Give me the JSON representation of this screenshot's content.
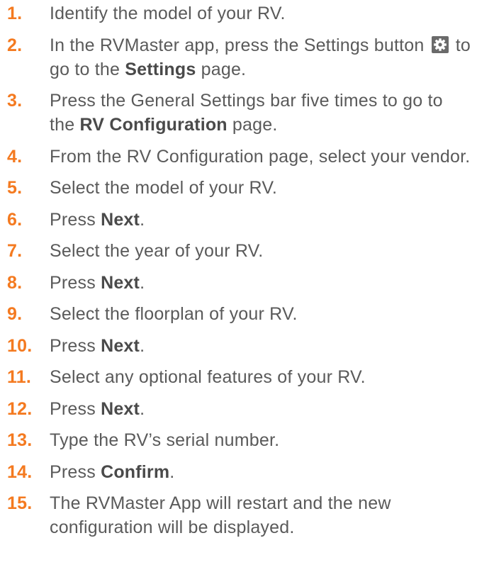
{
  "steps": [
    {
      "number": "1.",
      "parts": [
        {
          "t": "Identify the model of your RV."
        }
      ]
    },
    {
      "number": "2.",
      "parts": [
        {
          "t": "In the RVMaster app, press the Settings button "
        },
        {
          "icon": "settings-gear-icon"
        },
        {
          "t": " to go to the "
        },
        {
          "t": "Settings",
          "b": true
        },
        {
          "t": " page."
        }
      ]
    },
    {
      "number": "3.",
      "parts": [
        {
          "t": "Press the General Settings bar five times to go to the "
        },
        {
          "t": "RV Configuration",
          "b": true
        },
        {
          "t": " page."
        }
      ]
    },
    {
      "number": "4.",
      "parts": [
        {
          "t": "From the RV Configuration page, select your vendor."
        }
      ]
    },
    {
      "number": "5.",
      "parts": [
        {
          "t": "Select the model of your RV."
        }
      ]
    },
    {
      "number": "6.",
      "parts": [
        {
          "t": "Press "
        },
        {
          "t": "Next",
          "b": true
        },
        {
          "t": "."
        }
      ]
    },
    {
      "number": "7.",
      "parts": [
        {
          "t": "Select the year of your RV."
        }
      ]
    },
    {
      "number": "8.",
      "parts": [
        {
          "t": "Press "
        },
        {
          "t": "Next",
          "b": true
        },
        {
          "t": "."
        }
      ]
    },
    {
      "number": "9.",
      "parts": [
        {
          "t": "Select the floorplan of your RV."
        }
      ]
    },
    {
      "number": "10.",
      "parts": [
        {
          "t": "Press "
        },
        {
          "t": "Next",
          "b": true
        },
        {
          "t": "."
        }
      ]
    },
    {
      "number": "11.",
      "parts": [
        {
          "t": "Select any optional features of your RV."
        }
      ]
    },
    {
      "number": "12.",
      "parts": [
        {
          "t": "Press "
        },
        {
          "t": "Next",
          "b": true
        },
        {
          "t": "."
        }
      ]
    },
    {
      "number": "13.",
      "parts": [
        {
          "t": "Type the RV’s serial number."
        }
      ]
    },
    {
      "number": "14.",
      "parts": [
        {
          "t": "Press "
        },
        {
          "t": "Confirm",
          "b": true
        },
        {
          "t": "."
        }
      ]
    },
    {
      "number": "15.",
      "parts": [
        {
          "t": "The RVMaster App will restart and the new configuration will be displayed."
        }
      ]
    }
  ],
  "colors": {
    "number": "#f47a20",
    "text": "#5a5a5a",
    "emphasis": "#4a4a4a",
    "icon_bg": "#6a6a6a"
  }
}
